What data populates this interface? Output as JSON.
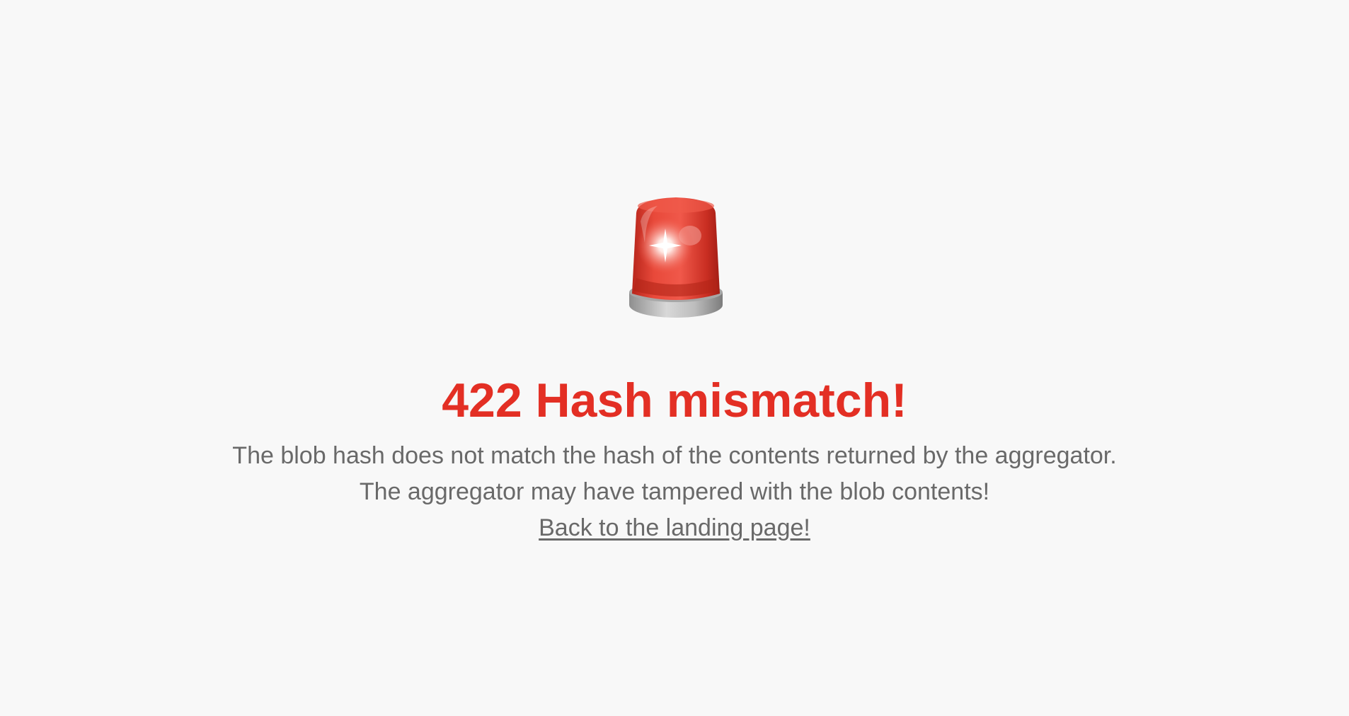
{
  "error": {
    "title": "422 Hash mismatch!",
    "line_1": "The blob hash does not match the hash of the contents returned by the aggregator.",
    "line_2": "The aggregator may have tampered with the blob contents!",
    "back_link": "Back to the landing page!",
    "icon": "police-car-light-icon"
  },
  "colors": {
    "background": "#f8f8f8",
    "title": "#e32f24",
    "text": "#696969"
  }
}
